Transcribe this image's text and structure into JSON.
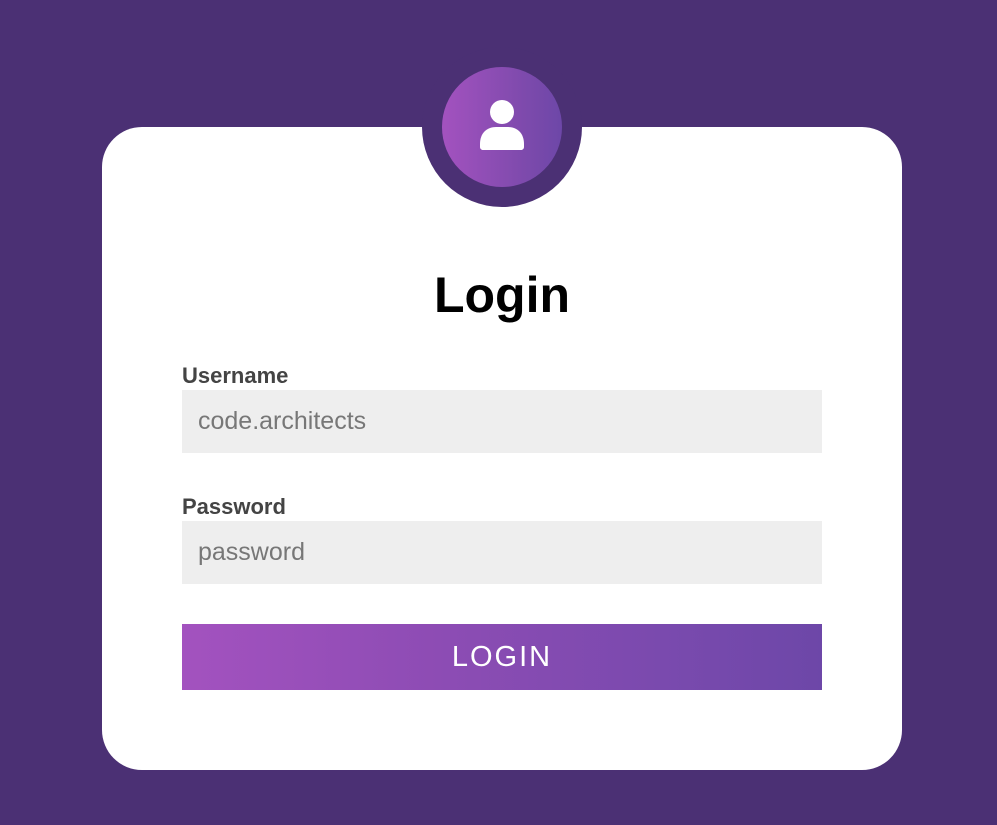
{
  "login_form": {
    "title": "Login",
    "username_label": "Username",
    "username_placeholder": "code.architects",
    "password_label": "Password",
    "password_placeholder": "password",
    "submit_label": "LOGIN",
    "avatar_icon": "user-icon"
  },
  "colors": {
    "background": "#4b3074",
    "card": "#ffffff",
    "accent_start": "#a352bf",
    "accent_end": "#6d47a8",
    "input_background": "#eeeeee",
    "label_text": "#444444"
  }
}
